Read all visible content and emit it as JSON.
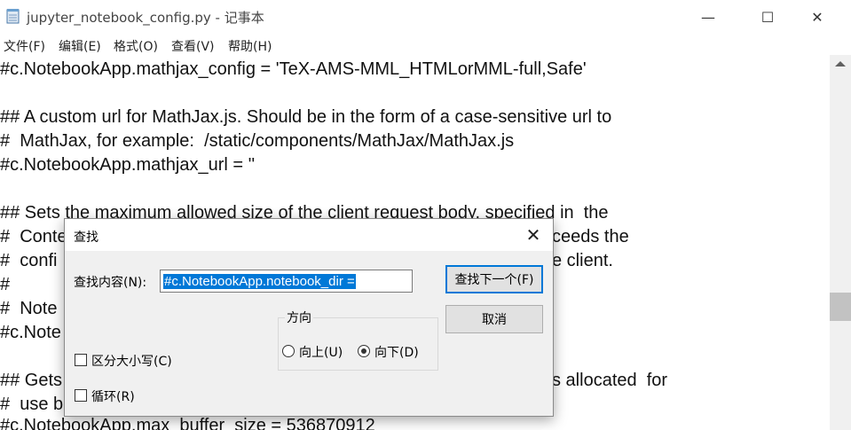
{
  "window": {
    "title": "jupyter_notebook_config.py - 记事本",
    "minimize_glyph": "—",
    "maximize_glyph": "☐",
    "close_glyph": "✕"
  },
  "menu": [
    {
      "label": "文件(F)"
    },
    {
      "label": "编辑(E)"
    },
    {
      "label": "格式(O)"
    },
    {
      "label": "查看(V)"
    },
    {
      "label": "帮助(H)"
    }
  ],
  "editor_lines": [
    "#c.NotebookApp.mathjax_config = 'TeX-AMS-MML_HTMLorMML-full,Safe'",
    "",
    "## A custom url for MathJax.js. Should be in the form of a case-sensitive url to",
    "#  MathJax, for example:  /static/components/MathJax/MathJax.js",
    "#c.NotebookApp.mathjax_url = ''",
    "",
    "## Sets the maximum allowed size of the client request body, specified in  the",
    "#  Conte",
    "#  confi",
    "#",
    "#  Note",
    "#c.Note",
    "",
    "## Gets",
    "#  use b",
    "#c.NotebookApp.max_buffer_size = 536870912"
  ],
  "editor_fragments": {
    "line8_tail": "ceeds the",
    "line9_tail": "e client.",
    "line14_tail": "s allocated  for"
  },
  "find_dialog": {
    "title": "查找",
    "close_glyph": "✕",
    "find_label": "查找内容(N):",
    "find_value": "#c.NotebookApp.notebook_dir =",
    "find_next_button": "查找下一个(F)",
    "cancel_button": "取消",
    "direction_label": "方向",
    "up_label": "向上(U)",
    "down_label": "向下(D)",
    "direction_selected": "down",
    "match_case_label": "区分大小写(C)",
    "match_case_checked": false,
    "wrap_label": "循环(R)",
    "wrap_checked": false
  }
}
